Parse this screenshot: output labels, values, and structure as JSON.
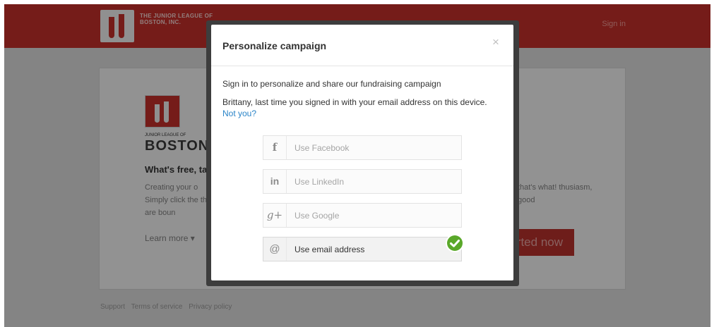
{
  "header": {
    "org_name_line1": "THE JUNIOR LEAGUE OF",
    "org_name_line2": "BOSTON, INC.",
    "sign_in": "Sign in"
  },
  "card": {
    "logo_small": "JUNIOR LEAGUE OF",
    "logo_big": "BOSTON",
    "heading": "What's free, ta",
    "body": "Creating your o Simply click the things are boun",
    "body_right": "that's what! thusiasm, good",
    "learn_more": "Learn more ▾",
    "cta_label": "rted now"
  },
  "footer": {
    "links": [
      "Support",
      "Terms of service",
      "Privacy policy"
    ]
  },
  "modal": {
    "title": "Personalize campaign",
    "close_glyph": "×",
    "intro": "Sign in to personalize and share our fundraising campaign",
    "last_signin": "Brittany, last time you signed in with your email address on this device.",
    "not_you": "Not you?",
    "providers": [
      {
        "icon": "facebook-icon",
        "glyph": "f",
        "label": "Use Facebook"
      },
      {
        "icon": "linkedin-icon",
        "glyph": "in",
        "label": "Use LinkedIn"
      },
      {
        "icon": "google-plus-icon",
        "glyph": "g+",
        "label": "Use Google"
      },
      {
        "icon": "at-sign-icon",
        "glyph": "@",
        "label": "Use email address"
      }
    ]
  },
  "colors": {
    "brand_red": "#c4302b",
    "link_blue": "#2a84c8",
    "check_green": "#5aa82a"
  }
}
